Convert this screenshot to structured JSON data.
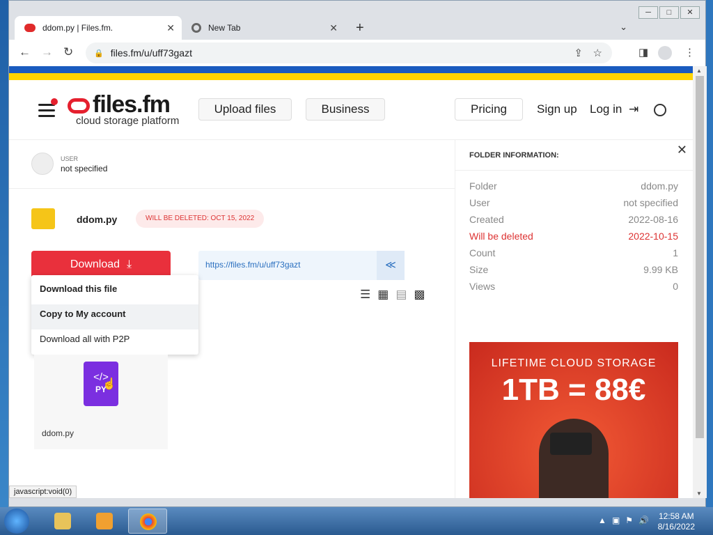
{
  "window": {
    "controls": [
      "─",
      "□",
      "✕"
    ]
  },
  "tabs": [
    {
      "title": "ddom.py | Files.fm.",
      "close": "✕"
    },
    {
      "title": "New Tab",
      "close": "✕"
    }
  ],
  "newtab_label": "+",
  "toolbar": {
    "back": "←",
    "forward": "→",
    "reload": "↻",
    "url": "files.fm/u/uff73gazt",
    "share_icon": "⇪",
    "star_icon": "☆",
    "side_icon": "◨",
    "menu_icon": "⋮"
  },
  "site": {
    "logo_brand": "files.fm",
    "logo_sub": "cloud storage platform",
    "nav": {
      "upload": "Upload files",
      "business": "Business",
      "pricing": "Pricing",
      "signup": "Sign up",
      "login": "Log in",
      "login_icon": "⇥"
    },
    "user": {
      "label": "USER",
      "value": "not specified"
    },
    "folder": {
      "name": "ddom.py",
      "delete_badge": "WILL BE DELETED: OCT 15, 2022"
    },
    "download": {
      "label": "Download",
      "icon": "⤓"
    },
    "share": {
      "url": "https://files.fm/u/uff73gazt",
      "icon": "≪"
    },
    "view_icons": [
      "☰",
      "▦",
      "▤",
      "▩"
    ],
    "menu": [
      "Download this file",
      "Copy to My account",
      "Download all with P2P"
    ],
    "file": {
      "code": "</>",
      "ext": "PY",
      "name": "ddom.py"
    },
    "info": {
      "title": "FOLDER INFORMATION:",
      "close": "✕",
      "rows": [
        {
          "label": "Folder",
          "value": "ddom.py",
          "color": "#888888"
        },
        {
          "label": "User",
          "value": "not specified",
          "color": "#888888"
        },
        {
          "label": "Created",
          "value": "2022-08-16",
          "color": "#888888"
        },
        {
          "label": "Will be deleted",
          "value": "2022-10-15",
          "color": "#dd3333"
        },
        {
          "label": "Count",
          "value": "1",
          "color": "#888888"
        },
        {
          "label": "Size",
          "value": "9.99 KB",
          "color": "#888888"
        },
        {
          "label": "Views",
          "value": "0",
          "color": "#888888"
        }
      ]
    },
    "ad": {
      "line1": "LIFETIME CLOUD STORAGE",
      "line2": "1TB = 88€"
    }
  },
  "status_text": "javascript:void(0)",
  "taskbar": {
    "time": "12:58 AM",
    "date": "8/16/2022",
    "tray_arrow": "▲"
  }
}
